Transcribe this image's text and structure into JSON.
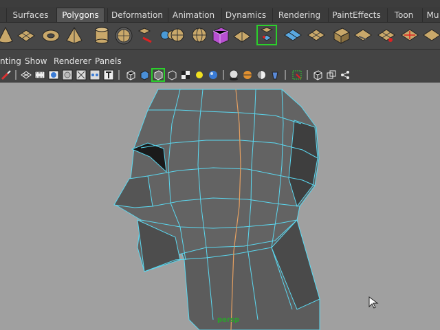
{
  "shelf_tabs": [
    "Surfaces",
    "Polygons",
    "Deformation",
    "Animation",
    "Dynamics",
    "Rendering",
    "PaintEffects",
    "Toon",
    "Mu"
  ],
  "active_tab": "Polygons",
  "shelf_icons": [
    "cone-icon",
    "plane-icon",
    "torus-icon",
    "pyramid-icon",
    "cylinder-icon",
    "smooth-sphere-icon",
    "extrude-edge-icon",
    "combine-icon",
    "separate-icon",
    "uv-sphere-icon",
    "cube-material-icon",
    "split-poly-icon",
    "append-poly-icon",
    "merge-vertex-icon",
    "uv-editor-icon",
    "cut-faces-icon",
    "wedge-icon",
    "soft-selection-icon",
    "bevel-icon",
    "poke-face-icon",
    "chip-off-icon",
    "crease-icon"
  ],
  "panel_menu": [
    "nting",
    "Show",
    "Renderer",
    "Panels"
  ],
  "view_tool_icons": [
    "paint-brush-icon",
    "wireframe-icon",
    "film-gate-icon",
    "camera-icon",
    "resolution-gate-icon",
    "safe-action-icon",
    "grid-view-icon",
    "texture-icon",
    "text-icon",
    "cube-wire-icon",
    "cube-shaded-icon",
    "select-object-icon",
    "cube-bbox-icon",
    "checker-icon",
    "light-icon",
    "sphere-shade-icon",
    "shadow-sphere-icon",
    "fog-icon",
    "half-sphere-icon",
    "paint-bucket-icon",
    "isolate-select-icon",
    "cube-outline-icon",
    "double-cube-icon",
    "share-icon"
  ],
  "viewport": {
    "camera_label": "persp",
    "background_color": "#a0a0a0",
    "wire_color": "#5bd8f0",
    "mesh_color": "#5e5e5e",
    "seam_color": "#e6a061"
  },
  "colors": {
    "active_tab_bg": "#555555",
    "selection_outline": "#2bd02b",
    "camera_label": "#2aa32a"
  }
}
